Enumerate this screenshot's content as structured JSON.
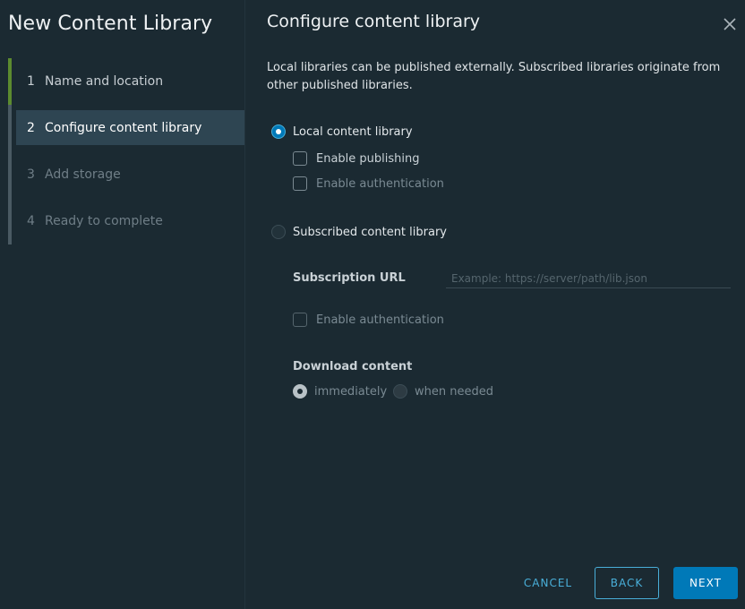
{
  "wizard": {
    "title": "New Content Library",
    "steps": [
      {
        "num": "1",
        "label": "Name and location",
        "state": "done"
      },
      {
        "num": "2",
        "label": "Configure content library",
        "state": "active"
      },
      {
        "num": "3",
        "label": "Add storage",
        "state": "pending"
      },
      {
        "num": "4",
        "label": "Ready to complete",
        "state": "pending"
      }
    ]
  },
  "page": {
    "title": "Configure content library",
    "close_icon": "close-icon",
    "description": "Local libraries can be published externally. Subscribed libraries originate from other published libraries."
  },
  "local": {
    "label": "Local content library",
    "selected": true,
    "enable_publishing": "Enable publishing",
    "enable_authentication": "Enable authentication"
  },
  "subscribed": {
    "label": "Subscribed content library",
    "selected": false,
    "url_label": "Subscription URL",
    "url_placeholder": "Example: https://server/path/lib.json",
    "enable_authentication": "Enable authentication",
    "download_label": "Download content",
    "download_options": [
      "immediately",
      "when needed"
    ],
    "download_selected": "immediately"
  },
  "footer": {
    "cancel": "CANCEL",
    "back": "BACK",
    "next": "NEXT"
  },
  "colors": {
    "accent": "#0079b8",
    "link": "#49afd9",
    "done_step": "#5c8b2f",
    "active_step_bg": "#2e4552"
  }
}
